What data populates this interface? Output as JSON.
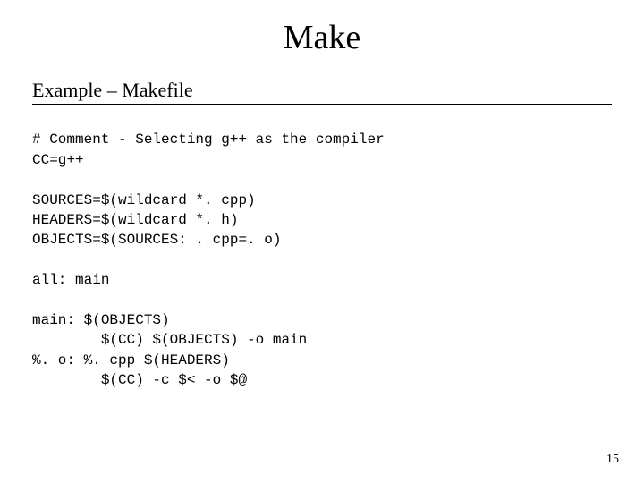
{
  "title": "Make",
  "subtitle": "Example – Makefile",
  "code_lines": {
    "l1": "# Comment - Selecting g++ as the compiler",
    "l2": "CC=g++",
    "l3": "",
    "l4": "SOURCES=$(wildcard *. cpp)",
    "l5": "HEADERS=$(wildcard *. h)",
    "l6": "OBJECTS=$(SOURCES: . cpp=. o)",
    "l7": "",
    "l8": "all: main",
    "l9": "",
    "l10": "main: $(OBJECTS)",
    "l11": "        $(CC) $(OBJECTS) -o main",
    "l12": "%. o: %. cpp $(HEADERS)",
    "l13": "        $(CC) -c $< -o $@"
  },
  "page_number": "15"
}
